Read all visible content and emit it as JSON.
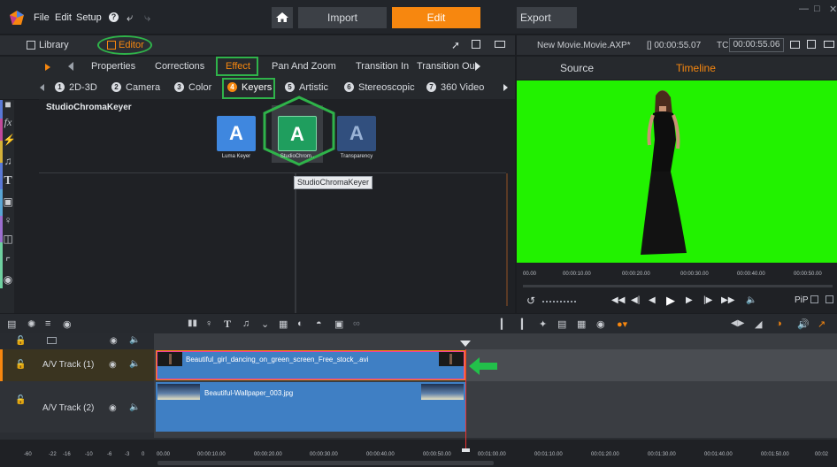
{
  "menu": {
    "file": "File",
    "edit": "Edit",
    "setup": "Setup"
  },
  "modes": {
    "import": "Import",
    "edit": "Edit",
    "export": "Export"
  },
  "library_bar": {
    "library": "Library",
    "editor": "Editor"
  },
  "tabs": [
    "Properties",
    "Corrections",
    "Effect",
    "Pan And Zoom",
    "Transition In",
    "Transition Ou"
  ],
  "subtabs": [
    {
      "num": "1",
      "label": "2D-3D"
    },
    {
      "num": "2",
      "label": "Camera"
    },
    {
      "num": "3",
      "label": "Color"
    },
    {
      "num": "4",
      "label": "Keyers"
    },
    {
      "num": "5",
      "label": "Artistic"
    },
    {
      "num": "6",
      "label": "Stereoscopic"
    },
    {
      "num": "7",
      "label": "360 Video"
    }
  ],
  "panel_title": "StudioChromaKeyer",
  "effects": [
    {
      "label": "Luma Keyer"
    },
    {
      "label": "StudioChrom.."
    },
    {
      "label": "Transparency"
    }
  ],
  "tooltip": "StudioChromaKeyer",
  "preview": {
    "title": "New Movie.Movie.AXP*",
    "duration": "[] 00:00:55.07",
    "tc_label": "TC",
    "tc": "00:00:55.06",
    "source": "Source",
    "timeline": "Timeline",
    "ticks": [
      "00.00",
      "00:00:10.00",
      "00:00:20.00",
      "00:00:30.00",
      "00:00:40.00",
      "00:00:50.00"
    ],
    "pip": "PiP"
  },
  "tracks": [
    {
      "name": "A/V Track (1)",
      "clip": "Beautiful_girl_dancing_on_green_screen_Free_stock_.avi"
    },
    {
      "name": "A/V Track (2)",
      "clip": "Beautiful-Wallpaper_003.jpg"
    }
  ],
  "timeline_ticks": [
    "00.00",
    "00:00:10.00",
    "00:00:20.00",
    "00:00:30.00",
    "00:00:40.00",
    "00:00:50.00",
    "00:01:00.00",
    "00:01:10.00",
    "00:01:20.00",
    "00:01:30.00",
    "00:01:40.00",
    "00:01:50.00",
    "00:02"
  ],
  "meter_ticks": [
    "-60",
    "-22",
    "-16",
    "-10",
    "-6",
    "-3",
    "0"
  ],
  "colors": {
    "accent": "#f7870f",
    "highlight": "#2fb34a",
    "chroma_green": "#22f200",
    "clip_blue": "#3f7fc4"
  }
}
